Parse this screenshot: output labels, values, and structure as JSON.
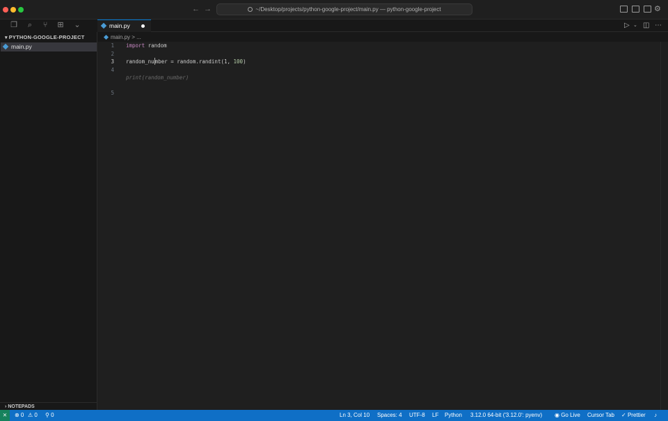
{
  "window": {
    "title": "~/Desktop/projects/python-google-project/main.py — python-google-project",
    "back_arrow": "←",
    "forward_arrow": "→"
  },
  "sidebar": {
    "project_header": "PYTHON-GOOGLE-PROJECT",
    "files": [
      {
        "name": "main.py",
        "selected": true
      }
    ],
    "notepads_header": "NOTEPADS"
  },
  "tabs": [
    {
      "label": "main.py",
      "modified": true
    }
  ],
  "breadcrumb": {
    "file": "main.py",
    "separator": ">",
    "rest": "..."
  },
  "editor": {
    "line_numbers": [
      "1",
      "2",
      "3",
      "4",
      "5"
    ],
    "active_line": "3",
    "lines": {
      "l1_kw": "import",
      "l1_rest": " random",
      "l3_a": "random_nu",
      "l3_b": "mber = random.randint(1, ",
      "l3_num": "100",
      "l3_end": ")",
      "ghost": "print(random_number)"
    }
  },
  "statusbar": {
    "errors": "⊗ 0",
    "warnings": "⚠ 0",
    "ports": "⚲ 0",
    "cursor_pos": "Ln 3, Col 10",
    "spaces": "Spaces: 4",
    "encoding": "UTF-8",
    "eol": "LF",
    "language": "Python",
    "interpreter": "3.12.0 64-bit ('3.12.0': pyenv)",
    "go_live": "Go Live",
    "cursor_tab": "Cursor Tab",
    "prettier": "Prettier"
  },
  "colors": {
    "accent": "#0078d4",
    "statusbar": "#0f6fc6",
    "keyword": "#c586c0",
    "number": "#b5cea8"
  }
}
